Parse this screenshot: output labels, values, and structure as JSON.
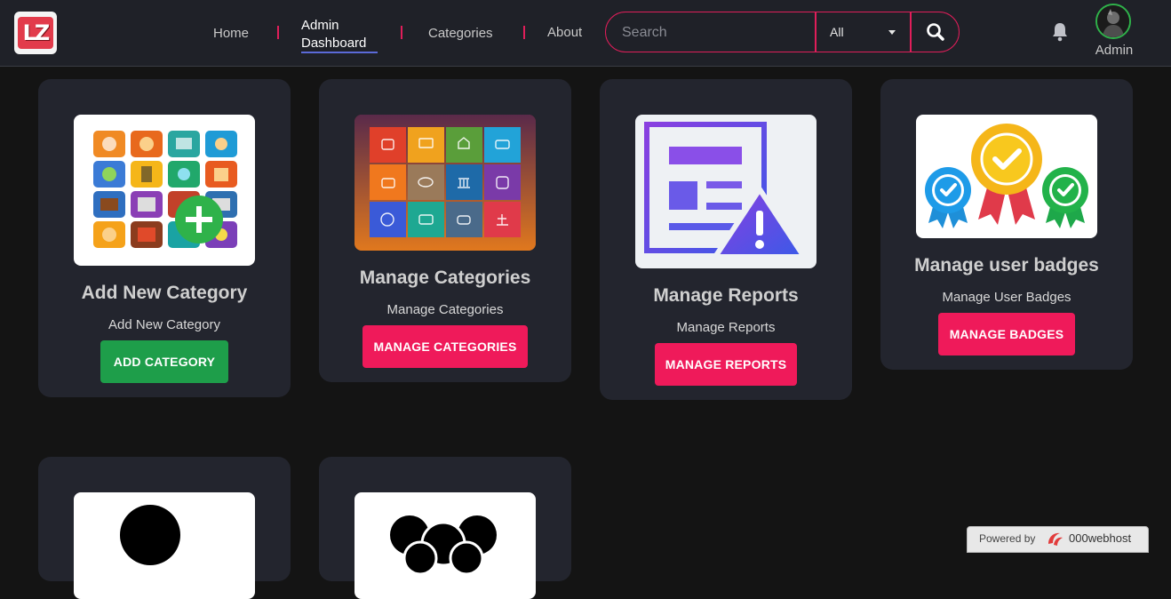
{
  "nav": {
    "logo_text": "LZ",
    "links": [
      "Home",
      "Admin Dashboard",
      "Categories",
      "About"
    ],
    "active_line1": "Admin",
    "active_line2": "Dashboard",
    "search_placeholder": "Search",
    "search_scope": "All",
    "user_label": "Admin"
  },
  "cards": [
    {
      "title": "Add New Category",
      "subtitle": "Add New Category",
      "button": "ADD CATEGORY"
    },
    {
      "title": "Manage Categories",
      "subtitle": "Manage Categories",
      "button": "MANAGE CATEGORIES"
    },
    {
      "title": "Manage Reports",
      "subtitle": "Manage Reports",
      "button": "MANAGE REPORTS"
    },
    {
      "title": "Manage user badges",
      "subtitle": "Manage User Badges",
      "button": "MANAGE BADGES"
    }
  ],
  "footer": {
    "powered_by": "Powered by",
    "host": "000webhost"
  },
  "colors": {
    "accent": "#ef1a5a",
    "green": "#1e9e4a",
    "background": "#141414",
    "card": "#23252e"
  }
}
